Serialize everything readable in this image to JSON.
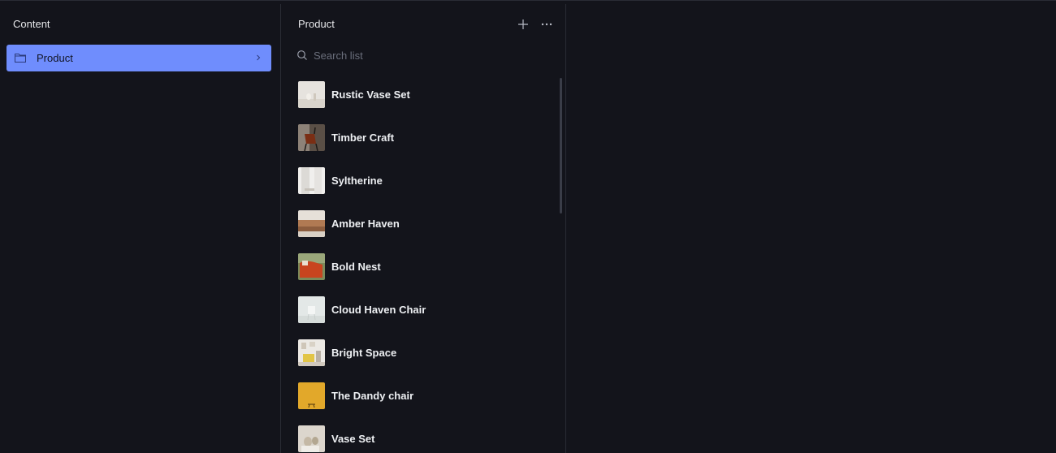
{
  "sidebar": {
    "title": "Content",
    "items": [
      {
        "label": "Product",
        "icon": "folder-icon",
        "selected": true
      }
    ]
  },
  "list_pane": {
    "title": "Product",
    "add_icon": "plus-icon",
    "more_icon": "more-horizontal-icon",
    "search": {
      "placeholder": "Search list",
      "value": ""
    },
    "items": [
      {
        "label": "Rustic Vase Set",
        "thumb": "rustic-vase-thumbnail"
      },
      {
        "label": "Timber Craft",
        "thumb": "timber-craft-thumbnail"
      },
      {
        "label": "Syltherine",
        "thumb": "syltherine-thumbnail"
      },
      {
        "label": "Amber Haven",
        "thumb": "amber-haven-thumbnail"
      },
      {
        "label": "Bold Nest",
        "thumb": "bold-nest-thumbnail"
      },
      {
        "label": "Cloud Haven Chair",
        "thumb": "cloud-haven-chair-thumbnail"
      },
      {
        "label": "Bright Space",
        "thumb": "bright-space-thumbnail"
      },
      {
        "label": "The Dandy chair",
        "thumb": "dandy-chair-thumbnail"
      },
      {
        "label": "Vase Set",
        "thumb": "vase-set-thumbnail"
      }
    ]
  },
  "colors": {
    "background": "#13141b",
    "accent": "#6f8dfd",
    "divider": "#2a2c35",
    "text": "#e6e7ea",
    "muted": "#6b6f7c"
  }
}
